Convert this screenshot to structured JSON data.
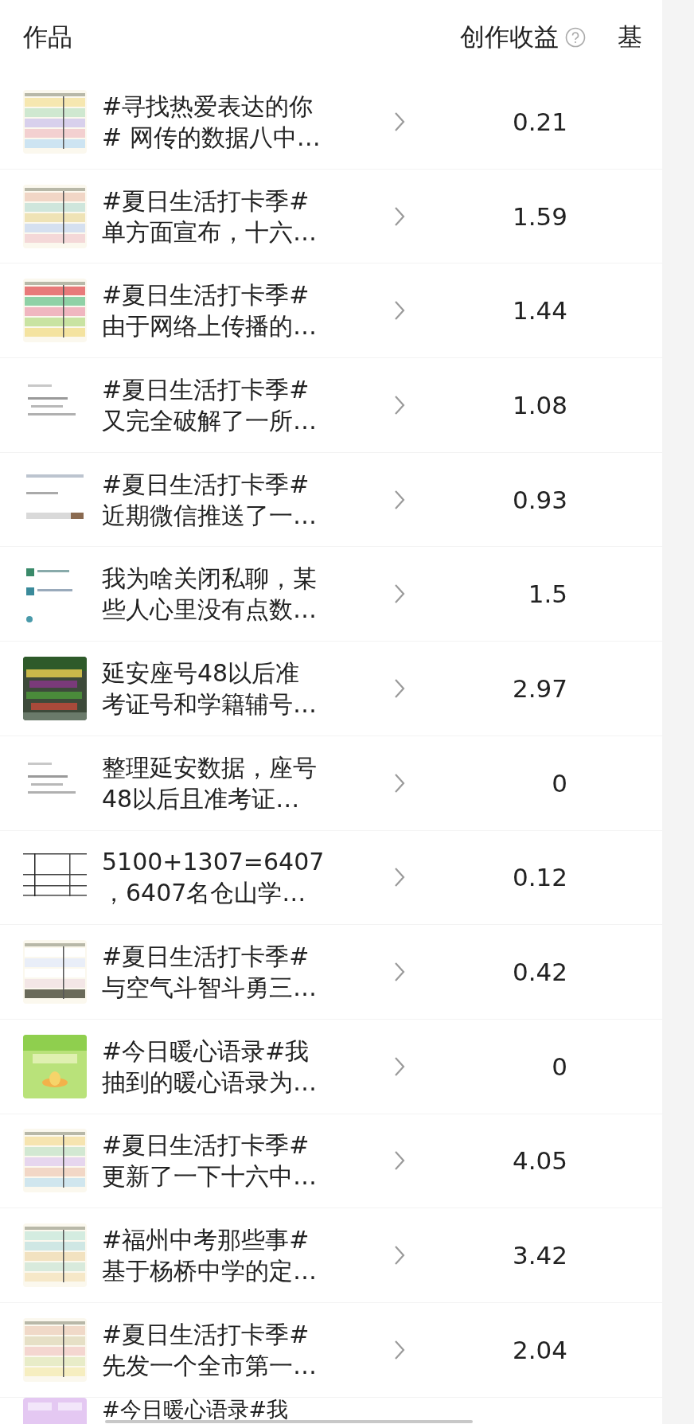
{
  "header": {
    "works": "作品",
    "earnings": "创作收益",
    "basic": "基"
  },
  "rows": [
    {
      "title_lines": [
        "#寻找热爱表达的你",
        "# 网传的数据八中…"
      ],
      "earnings": "0.21"
    },
    {
      "title_lines": [
        "#夏日生活打卡季#",
        "单方面宣布，十六…"
      ],
      "earnings": "1.59"
    },
    {
      "title_lines": [
        "#夏日生活打卡季#",
        "由于网络上传播的…"
      ],
      "earnings": "1.44"
    },
    {
      "title_lines": [
        "#夏日生活打卡季#",
        "又完全破解了一所…"
      ],
      "earnings": "1.08"
    },
    {
      "title_lines": [
        "#夏日生活打卡季#",
        "近期微信推送了一…"
      ],
      "earnings": "0.93"
    },
    {
      "title_lines": [
        "我为啥关闭私聊，某",
        "些人心里没有点数…"
      ],
      "earnings": "1.5"
    },
    {
      "title_lines": [
        "延安座号48以后准",
        "考证号和学籍辅号…"
      ],
      "earnings": "2.97"
    },
    {
      "title_lines": [
        "整理延安数据，座号",
        "48以后且准考证…"
      ],
      "earnings": "0"
    },
    {
      "title_lines": [
        "5100+1307=6407",
        "，6407名仓山学…"
      ],
      "earnings": "0.12"
    },
    {
      "title_lines": [
        "#夏日生活打卡季#",
        "与空气斗智斗勇三…"
      ],
      "earnings": "0.42"
    },
    {
      "title_lines": [
        "#今日暖心语录#我",
        "抽到的暖心语录为…"
      ],
      "earnings": "0"
    },
    {
      "title_lines": [
        "#夏日生活打卡季#",
        "更新了一下十六中…"
      ],
      "earnings": "4.05"
    },
    {
      "title_lines": [
        "#福州中考那些事#",
        "基于杨桥中学的定…"
      ],
      "earnings": "3.42"
    },
    {
      "title_lines": [
        "#夏日生活打卡季#",
        "先发一个全市第一…"
      ],
      "earnings": "2.04"
    },
    {
      "title_lines": [
        "#今日暖心语录#我"
      ]
    }
  ]
}
